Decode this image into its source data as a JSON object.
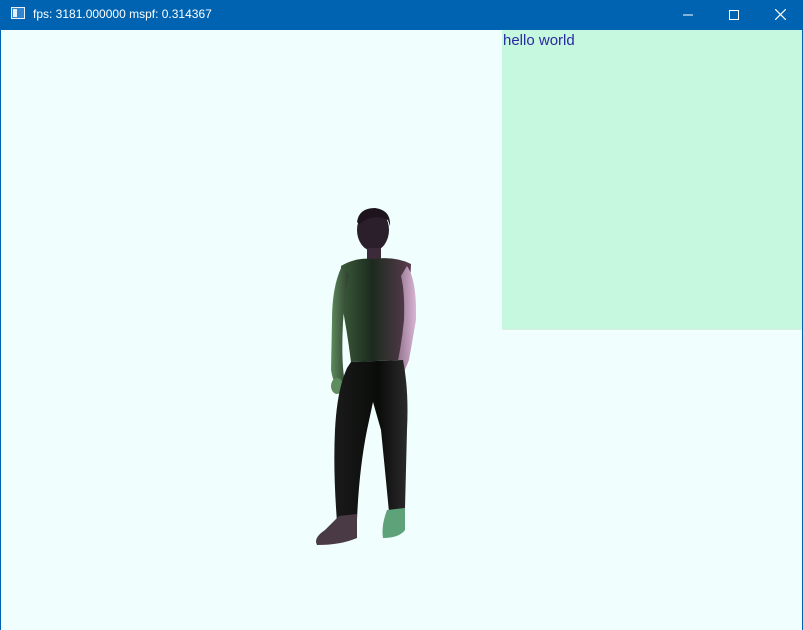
{
  "window": {
    "title": "fps: 3181.000000 mspf: 0.314367",
    "icon": "app-window-icon",
    "controls": [
      "minimize-icon",
      "maximize-icon",
      "close-icon"
    ],
    "accent_color": "#0063b1"
  },
  "viewport": {
    "background_color": "#f0fffe",
    "overlay": {
      "text": "hello world",
      "background_color": "#c6f7df",
      "text_color": "#2a2aa0"
    },
    "model": {
      "kind": "3d-human-figure"
    }
  }
}
